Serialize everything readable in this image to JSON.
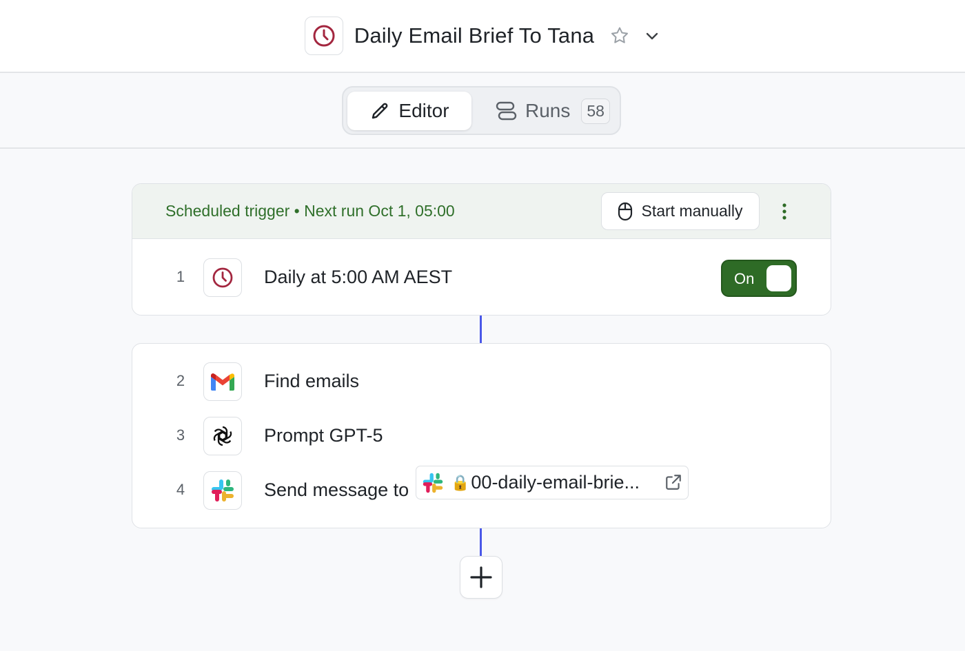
{
  "header": {
    "title": "Daily Email Brief To Tana",
    "icons": {
      "workflow": "clock-icon",
      "favorite": "star-icon",
      "menu": "chevron-down-icon"
    }
  },
  "tabs": {
    "editor_label": "Editor",
    "runs_label": "Runs",
    "runs_count": "58",
    "active": "Editor"
  },
  "trigger": {
    "status_text": "Scheduled trigger • Next run Oct 1, 05:00",
    "start_label": "Start manually"
  },
  "steps": [
    {
      "number": "1",
      "label": "Daily at 5:00 AM AEST",
      "icon": "clock-icon",
      "toggle_label": "On",
      "enabled": true
    },
    {
      "number": "2",
      "label": "Find emails",
      "icon": "gmail-icon"
    },
    {
      "number": "3",
      "label": "Prompt GPT-5",
      "icon": "openai-icon"
    },
    {
      "number": "4",
      "label": "Send message to",
      "icon": "slack-icon",
      "channel": {
        "lock": "🔒",
        "name": "00-daily-email-brie..."
      }
    }
  ],
  "colors": {
    "accent_green": "#2e6b26",
    "trigger_text": "#2f6f2a",
    "connector": "#4a58e8",
    "clock_red": "#a3263f"
  }
}
